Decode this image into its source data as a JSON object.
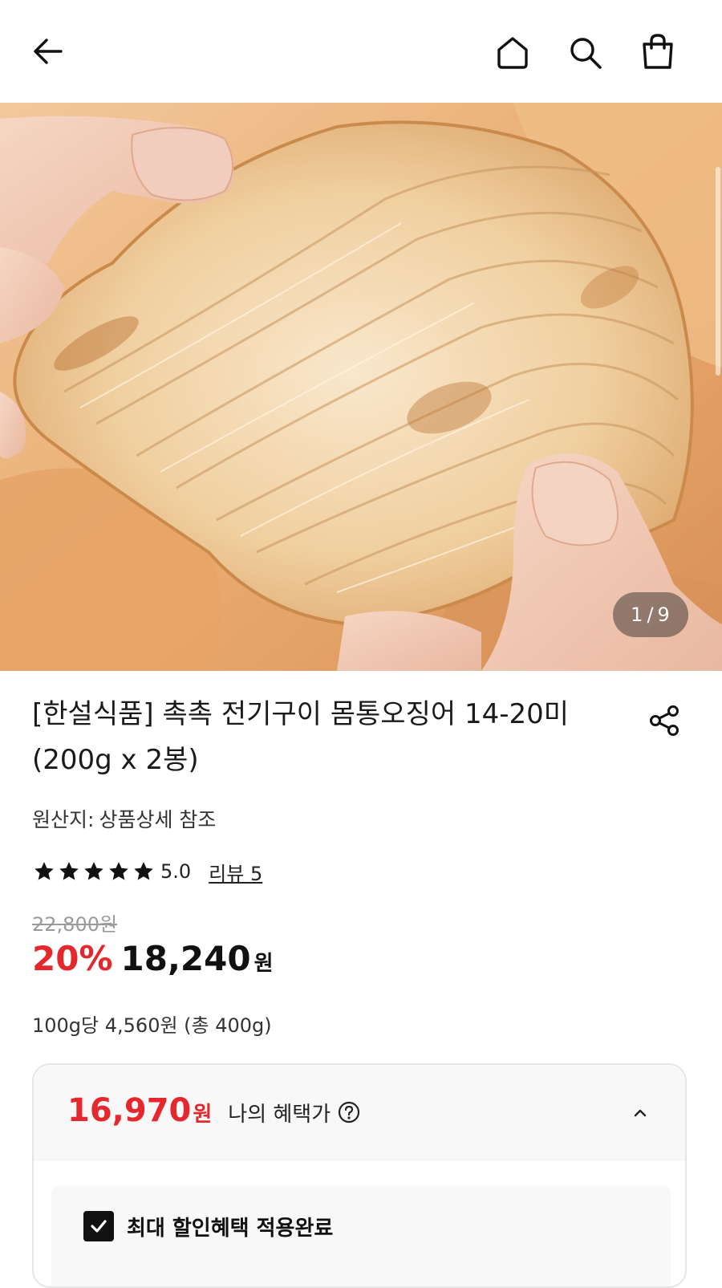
{
  "header": {
    "back_icon": "arrow-left-icon",
    "home_icon": "home-icon",
    "search_icon": "search-icon",
    "cart_icon": "shopping-bag-icon"
  },
  "gallery": {
    "current": "1",
    "separator": "/",
    "total": "9",
    "image_subject": "dried squid product photo"
  },
  "product": {
    "title": "[한설식품] 촉촉 전기구이 몸통오징어 14-20미 (200g x 2봉)",
    "share_icon": "share-icon",
    "origin_label": "원산지:",
    "origin_value": "상품상세 참조",
    "rating_value": "5.0",
    "rating_stars": 5,
    "review_text": "리뷰 5"
  },
  "pricing": {
    "original_price": "22,800원",
    "discount_rate": "20%",
    "sale_price": "18,240",
    "currency": "원",
    "unit_price": "100g당 4,560원 (총 400g)"
  },
  "benefit": {
    "price": "16,970",
    "currency": "원",
    "label": "나의 혜택가",
    "help_icon": "question-circle-icon",
    "toggle_icon": "chevron-up-icon",
    "checkbox_label": "최대 할인혜택 적용완료",
    "checked": true
  },
  "colors": {
    "accent_red": "#e5282d",
    "text": "#111111",
    "muted": "#9a9a9a"
  }
}
